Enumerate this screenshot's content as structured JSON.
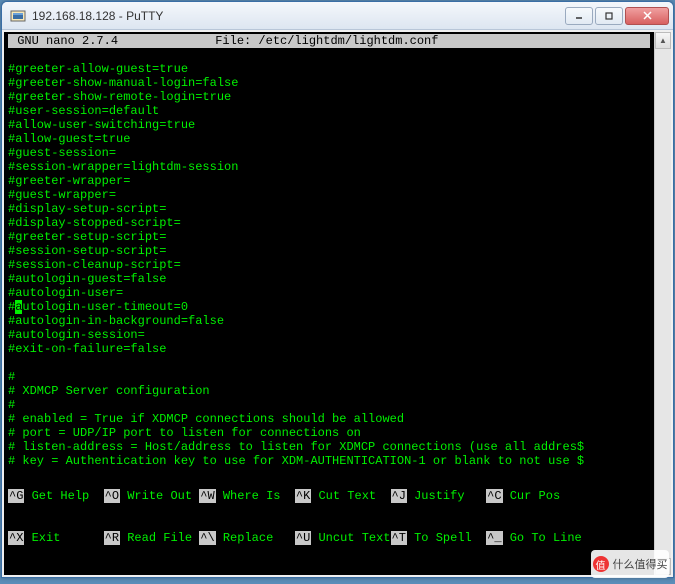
{
  "window": {
    "title": "192.168.18.128 - PuTTY"
  },
  "editor": {
    "header_app": " GNU nano 2.7.4 ",
    "header_file": "File: /etc/lightdm/lightdm.conf"
  },
  "lines": [
    "#greeter-allow-guest=true",
    "#greeter-show-manual-login=false",
    "#greeter-show-remote-login=true",
    "#user-session=default",
    "#allow-user-switching=true",
    "#allow-guest=true",
    "#guest-session=",
    "#session-wrapper=lightdm-session",
    "#greeter-wrapper=",
    "#guest-wrapper=",
    "#display-setup-script=",
    "#display-stopped-script=",
    "#greeter-setup-script=",
    "#session-setup-script=",
    "#session-cleanup-script=",
    "#autologin-guest=false",
    "#autologin-user=",
    "#autologin-user-timeout=0",
    "#autologin-in-background=false",
    "#autologin-session=",
    "#exit-on-failure=false",
    "",
    "#",
    "# XDMCP Server configuration",
    "#",
    "# enabled = True if XDMCP connections should be allowed",
    "# port = UDP/IP port to listen for connections on",
    "# listen-address = Host/address to listen for XDMCP connections (use all addres$",
    "# key = Authentication key to use for XDM-AUTHENTICATION-1 or blank to not use $"
  ],
  "cursor_line_index": 17,
  "shortcuts": {
    "row1": [
      {
        "k": "^G",
        "l": " Get Help  "
      },
      {
        "k": "^O",
        "l": " Write Out "
      },
      {
        "k": "^W",
        "l": " Where Is  "
      },
      {
        "k": "^K",
        "l": " Cut Text  "
      },
      {
        "k": "^J",
        "l": " Justify   "
      },
      {
        "k": "^C",
        "l": " Cur Pos   "
      }
    ],
    "row2": [
      {
        "k": "^X",
        "l": " Exit      "
      },
      {
        "k": "^R",
        "l": " Read File "
      },
      {
        "k": "^\\",
        "l": " Replace   "
      },
      {
        "k": "^U",
        "l": " Uncut Text"
      },
      {
        "k": "^T",
        "l": " To Spell  "
      },
      {
        "k": "^_",
        "l": " Go To Line"
      }
    ]
  },
  "watermark": {
    "glyph": "值",
    "text": "什么值得买"
  }
}
